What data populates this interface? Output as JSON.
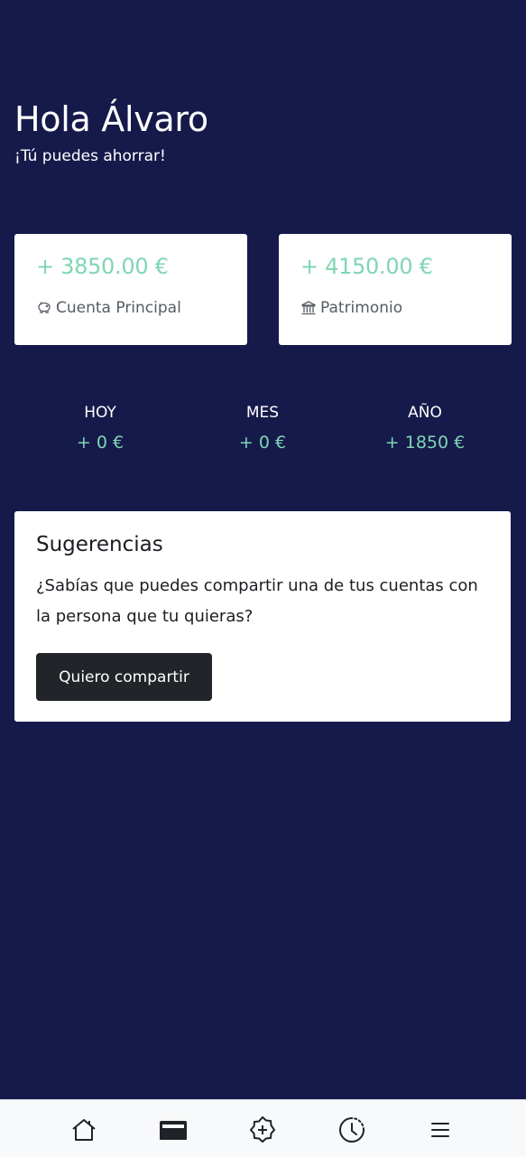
{
  "greeting": {
    "title": "Hola Álvaro",
    "subtitle": "¡Tú puedes ahorrar!"
  },
  "accounts": [
    {
      "amount": "+ 3850.00 €",
      "label": "Cuenta Principal",
      "icon": "piggy-bank-icon"
    },
    {
      "amount": "+ 4150.00 €",
      "label": "Patrimonio",
      "icon": "bank-icon"
    }
  ],
  "stats": [
    {
      "label": "HOY",
      "value": "+ 0 €"
    },
    {
      "label": "MES",
      "value": "+ 0 €"
    },
    {
      "label": "AÑO",
      "value": "+ 1850 €"
    }
  ],
  "suggestions": {
    "title": "Sugerencias",
    "text": "¿Sabías que puedes compartir una de tus cuentas con la persona que tu quieras?",
    "button_label": "Quiero compartir"
  },
  "nav": {
    "items": [
      "home-icon",
      "wallet-icon",
      "add-icon",
      "history-icon",
      "menu-icon"
    ]
  },
  "colors": {
    "background": "#161a4b",
    "accent_green": "#7fd6b3",
    "button_dark": "#212529"
  }
}
